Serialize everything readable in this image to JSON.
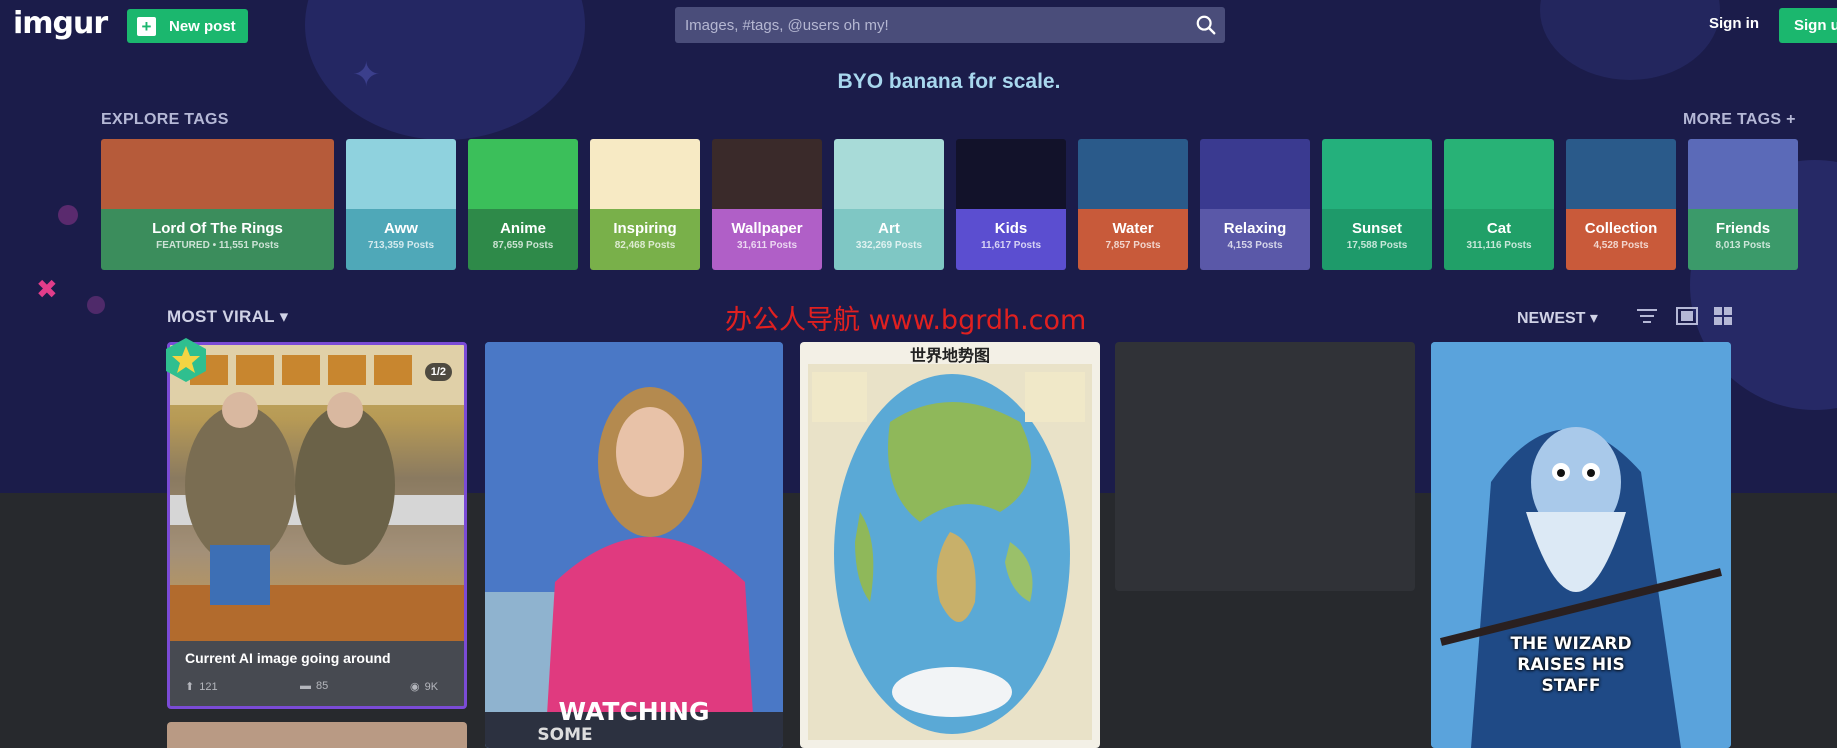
{
  "header": {
    "logo": "imgur",
    "new_post_label": "New post",
    "search_placeholder": "Images, #tags, @users oh my!",
    "signin_label": "Sign in",
    "signup_label": "Sign up"
  },
  "tagline": "BYO banana for scale.",
  "explore": {
    "label": "EXPLORE TAGS",
    "more_label": "MORE TAGS +",
    "tags": [
      {
        "name": "Lord Of The Rings",
        "count": "FEATURED • 11,551 Posts",
        "color": "#3b8d5c",
        "art": "#b65b3a"
      },
      {
        "name": "Aww",
        "count": "713,359 Posts",
        "color": "#4fa8b8",
        "art": "#8fd2de"
      },
      {
        "name": "Anime",
        "count": "87,659 Posts",
        "color": "#2e8a49",
        "art": "#3bbf5a"
      },
      {
        "name": "Inspiring",
        "count": "82,468 Posts",
        "color": "#79b04a",
        "art": "#f7eac4"
      },
      {
        "name": "Wallpaper",
        "count": "31,611 Posts",
        "color": "#b05fc7",
        "art": "#3a2a2a"
      },
      {
        "name": "Art",
        "count": "332,269 Posts",
        "color": "#7fc7c4",
        "art": "#a8dbd8"
      },
      {
        "name": "Kids",
        "count": "11,617 Posts",
        "color": "#5b4ed0",
        "art": "#12122a"
      },
      {
        "name": "Water",
        "count": "7,857 Posts",
        "color": "#c85a3a",
        "art": "#2a5a8a"
      },
      {
        "name": "Relaxing",
        "count": "4,153 Posts",
        "color": "#5a58a8",
        "art": "#3a3a90"
      },
      {
        "name": "Sunset",
        "count": "17,588 Posts",
        "color": "#1e9a6a",
        "art": "#24b07c"
      },
      {
        "name": "Cat",
        "count": "311,116 Posts",
        "color": "#21a068",
        "art": "#28b276"
      },
      {
        "name": "Collection",
        "count": "4,528 Posts",
        "color": "#c95a3a",
        "art": "#2a5a8a"
      },
      {
        "name": "Friends",
        "count": "8,013 Posts",
        "color": "#3b9a6a",
        "art": "#5b6ab8"
      }
    ]
  },
  "watermark": "办公人导航  www.bgrdh.com",
  "feed": {
    "section_label": "MOST VIRAL",
    "sort_label": "NEWEST",
    "posts": [
      {
        "title": "Current AI image going around",
        "upvotes": "121",
        "comments": "85",
        "views": "9K",
        "page_badge": "1/2"
      },
      {
        "overlay_text": "WATCHING",
        "overlay_sub": "SOME"
      },
      {
        "map_title": "世界地势图"
      },
      {},
      {
        "overlay_text": "THE WIZARD RAISES HIS STAFF"
      }
    ]
  }
}
